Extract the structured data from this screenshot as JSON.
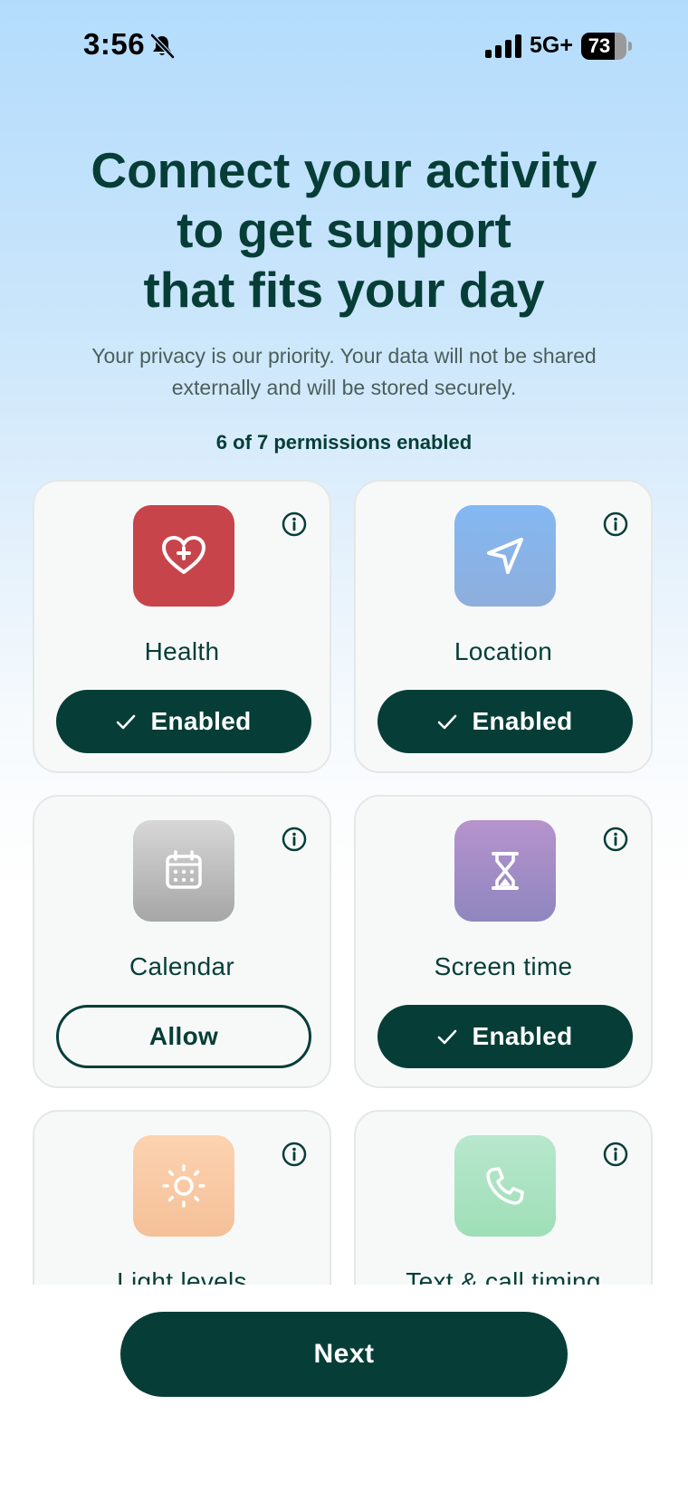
{
  "status_bar": {
    "time": "3:56",
    "network": "5G+",
    "battery": "73",
    "battery_level": 0.73,
    "icons": [
      "bell-slash-icon",
      "signal-icon",
      "battery-icon"
    ]
  },
  "header": {
    "title_lines": [
      "Connect your activity",
      "to get support",
      "that fits your day"
    ],
    "subtitle_lines": [
      "Your privacy is our priority. Your data will not be shared",
      "externally and will be stored securely."
    ],
    "permissions_status": "6 of 7 permissions enabled"
  },
  "permissions": [
    {
      "label": "Health",
      "icon": "heart-plus-icon",
      "button": "Enabled",
      "state": "enabled",
      "color": "#c8444b"
    },
    {
      "label": "Location",
      "icon": "location-arrow-icon",
      "button": "Enabled",
      "state": "enabled",
      "color": "#83b8f2"
    },
    {
      "label": "Calendar",
      "icon": "calendar-icon",
      "button": "Allow",
      "state": "not-enabled",
      "color": "#bcbcbc"
    },
    {
      "label": "Screen time",
      "icon": "hourglass-icon",
      "button": "Enabled",
      "state": "enabled",
      "color": "#a48dc7"
    },
    {
      "label": "Light levels",
      "icon": "sun-icon",
      "button": "",
      "state": "",
      "color": "#f8c9a3"
    },
    {
      "label": "Text & call timing",
      "icon": "phone-icon",
      "button": "",
      "state": "",
      "color": "#abe3c2"
    }
  ],
  "footer": {
    "next_label": "Next"
  },
  "colors": {
    "primary": "#063e37",
    "card_background": "#f7f9f9",
    "background_top": "#b3dcfc"
  }
}
